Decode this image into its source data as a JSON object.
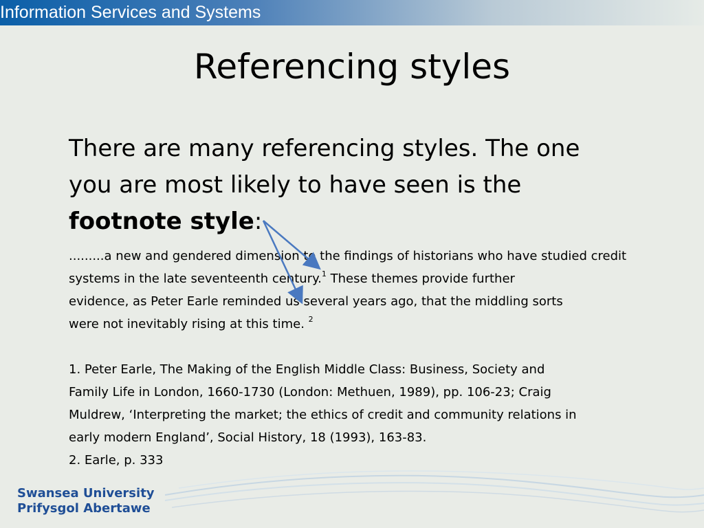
{
  "header": {
    "text": "Information Services and Systems"
  },
  "title": "Referencing styles",
  "intro": {
    "line1": "There are many referencing styles.  The one",
    "line2": "you are most likely to have seen is the",
    "bold": "footnote style",
    "colon": ":"
  },
  "excerpt": {
    "l1": ".........a new and  gendered dimension to the findings of historians who have studied  credit",
    "l2a": "systems in the late seventeenth century.",
    "l2sup": "1",
    "l2b": " These themes provide further",
    "l3": "evidence, as Peter Earle reminded us several years ago, that the middling sorts",
    "l4a": "were not inevitably rising at this time. ",
    "l4sup": "2"
  },
  "footnotes": {
    "f1a": "1.  Peter Earle,  The Making of the English Middle Class: Business, Society and",
    "f1b": "Family Life in London, 1660-1730 (London: Methuen, 1989), pp. 106-23; Craig",
    "f1c": "Muldrew, ‘Interpreting the market; the ethics of credit and community relations in",
    "f1d": "early modern England’, Social History, 18 (1993), 163-83.",
    "f2": "2.   Earle, p. 333"
  },
  "logo": {
    "line1": "Swansea University",
    "line2": "Prifysgol Abertawe"
  },
  "colors": {
    "header_blue": "#0b5fa8",
    "logo_blue": "#1f4e96",
    "arrow": "#4a79c0"
  }
}
